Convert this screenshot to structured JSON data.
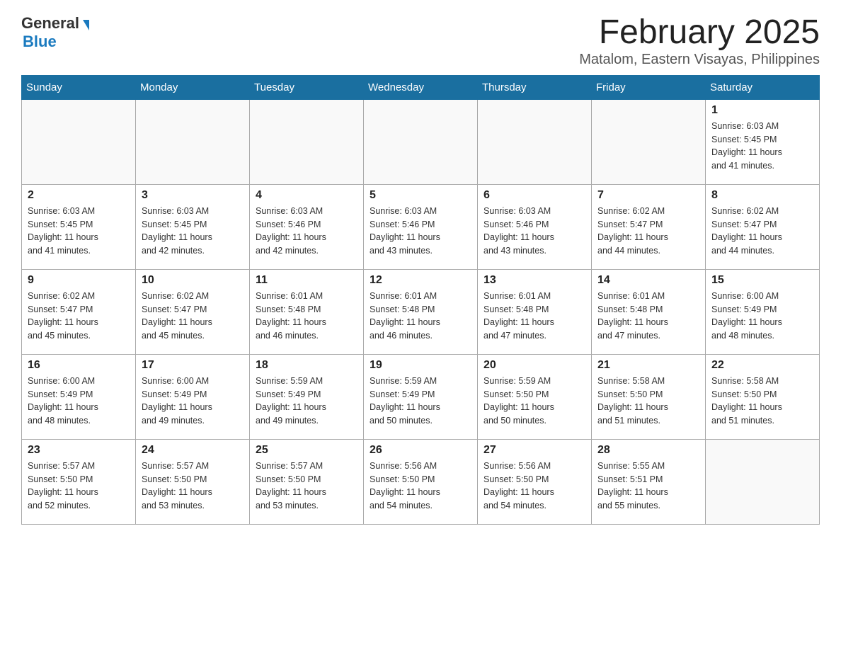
{
  "header": {
    "logo_general": "General",
    "logo_blue": "Blue",
    "month_title": "February 2025",
    "location": "Matalom, Eastern Visayas, Philippines"
  },
  "weekdays": [
    "Sunday",
    "Monday",
    "Tuesday",
    "Wednesday",
    "Thursday",
    "Friday",
    "Saturday"
  ],
  "weeks": [
    [
      {
        "day": "",
        "info": ""
      },
      {
        "day": "",
        "info": ""
      },
      {
        "day": "",
        "info": ""
      },
      {
        "day": "",
        "info": ""
      },
      {
        "day": "",
        "info": ""
      },
      {
        "day": "",
        "info": ""
      },
      {
        "day": "1",
        "info": "Sunrise: 6:03 AM\nSunset: 5:45 PM\nDaylight: 11 hours\nand 41 minutes."
      }
    ],
    [
      {
        "day": "2",
        "info": "Sunrise: 6:03 AM\nSunset: 5:45 PM\nDaylight: 11 hours\nand 41 minutes."
      },
      {
        "day": "3",
        "info": "Sunrise: 6:03 AM\nSunset: 5:45 PM\nDaylight: 11 hours\nand 42 minutes."
      },
      {
        "day": "4",
        "info": "Sunrise: 6:03 AM\nSunset: 5:46 PM\nDaylight: 11 hours\nand 42 minutes."
      },
      {
        "day": "5",
        "info": "Sunrise: 6:03 AM\nSunset: 5:46 PM\nDaylight: 11 hours\nand 43 minutes."
      },
      {
        "day": "6",
        "info": "Sunrise: 6:03 AM\nSunset: 5:46 PM\nDaylight: 11 hours\nand 43 minutes."
      },
      {
        "day": "7",
        "info": "Sunrise: 6:02 AM\nSunset: 5:47 PM\nDaylight: 11 hours\nand 44 minutes."
      },
      {
        "day": "8",
        "info": "Sunrise: 6:02 AM\nSunset: 5:47 PM\nDaylight: 11 hours\nand 44 minutes."
      }
    ],
    [
      {
        "day": "9",
        "info": "Sunrise: 6:02 AM\nSunset: 5:47 PM\nDaylight: 11 hours\nand 45 minutes."
      },
      {
        "day": "10",
        "info": "Sunrise: 6:02 AM\nSunset: 5:47 PM\nDaylight: 11 hours\nand 45 minutes."
      },
      {
        "day": "11",
        "info": "Sunrise: 6:01 AM\nSunset: 5:48 PM\nDaylight: 11 hours\nand 46 minutes."
      },
      {
        "day": "12",
        "info": "Sunrise: 6:01 AM\nSunset: 5:48 PM\nDaylight: 11 hours\nand 46 minutes."
      },
      {
        "day": "13",
        "info": "Sunrise: 6:01 AM\nSunset: 5:48 PM\nDaylight: 11 hours\nand 47 minutes."
      },
      {
        "day": "14",
        "info": "Sunrise: 6:01 AM\nSunset: 5:48 PM\nDaylight: 11 hours\nand 47 minutes."
      },
      {
        "day": "15",
        "info": "Sunrise: 6:00 AM\nSunset: 5:49 PM\nDaylight: 11 hours\nand 48 minutes."
      }
    ],
    [
      {
        "day": "16",
        "info": "Sunrise: 6:00 AM\nSunset: 5:49 PM\nDaylight: 11 hours\nand 48 minutes."
      },
      {
        "day": "17",
        "info": "Sunrise: 6:00 AM\nSunset: 5:49 PM\nDaylight: 11 hours\nand 49 minutes."
      },
      {
        "day": "18",
        "info": "Sunrise: 5:59 AM\nSunset: 5:49 PM\nDaylight: 11 hours\nand 49 minutes."
      },
      {
        "day": "19",
        "info": "Sunrise: 5:59 AM\nSunset: 5:49 PM\nDaylight: 11 hours\nand 50 minutes."
      },
      {
        "day": "20",
        "info": "Sunrise: 5:59 AM\nSunset: 5:50 PM\nDaylight: 11 hours\nand 50 minutes."
      },
      {
        "day": "21",
        "info": "Sunrise: 5:58 AM\nSunset: 5:50 PM\nDaylight: 11 hours\nand 51 minutes."
      },
      {
        "day": "22",
        "info": "Sunrise: 5:58 AM\nSunset: 5:50 PM\nDaylight: 11 hours\nand 51 minutes."
      }
    ],
    [
      {
        "day": "23",
        "info": "Sunrise: 5:57 AM\nSunset: 5:50 PM\nDaylight: 11 hours\nand 52 minutes."
      },
      {
        "day": "24",
        "info": "Sunrise: 5:57 AM\nSunset: 5:50 PM\nDaylight: 11 hours\nand 53 minutes."
      },
      {
        "day": "25",
        "info": "Sunrise: 5:57 AM\nSunset: 5:50 PM\nDaylight: 11 hours\nand 53 minutes."
      },
      {
        "day": "26",
        "info": "Sunrise: 5:56 AM\nSunset: 5:50 PM\nDaylight: 11 hours\nand 54 minutes."
      },
      {
        "day": "27",
        "info": "Sunrise: 5:56 AM\nSunset: 5:50 PM\nDaylight: 11 hours\nand 54 minutes."
      },
      {
        "day": "28",
        "info": "Sunrise: 5:55 AM\nSunset: 5:51 PM\nDaylight: 11 hours\nand 55 minutes."
      },
      {
        "day": "",
        "info": ""
      }
    ]
  ]
}
